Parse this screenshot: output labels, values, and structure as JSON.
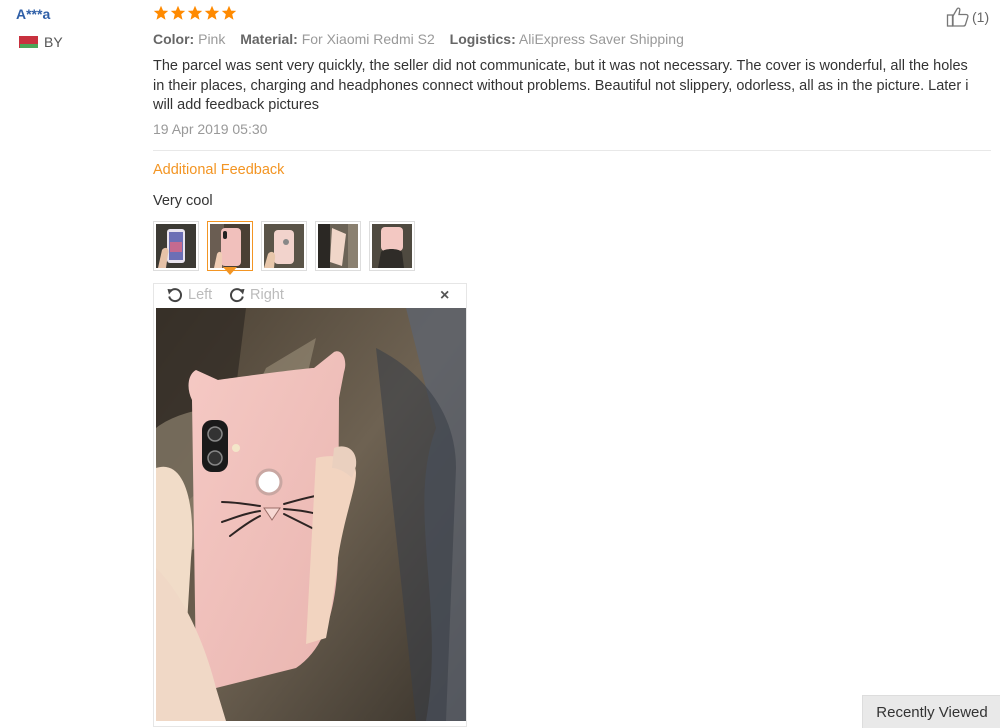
{
  "review": {
    "user": "A***a",
    "country": "BY",
    "rating": 5,
    "attributes": [
      {
        "label": "Color:",
        "value": "Pink"
      },
      {
        "label": "Material:",
        "value": "For Xiaomi Redmi S2"
      },
      {
        "label": "Logistics:",
        "value": "AliExpress Saver Shipping"
      }
    ],
    "text": "The parcel was sent very quickly, the seller did not communicate, but it was not necessary. The cover is wonderful, all the holes in their places, charging and headphones connect without problems. Beautiful not slippery, odorless, all as in the picture. Later i will add feedback pictures",
    "date": "19 Apr 2019 05:30",
    "likes": "(1)"
  },
  "additional": {
    "heading": "Additional Feedback",
    "text": "Very cool",
    "selected_index": 1
  },
  "viewer": {
    "left_label": "Left",
    "right_label": "Right",
    "close_symbol": "×"
  },
  "recently_viewed": "Recently Viewed",
  "colors": {
    "accent": "#f39523",
    "username": "#2f5fa7",
    "star": "#ff8a00"
  }
}
